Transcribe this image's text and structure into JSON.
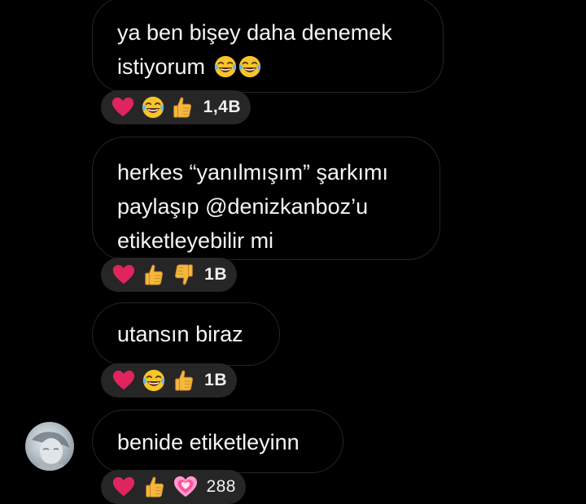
{
  "messages": [
    {
      "lines": [
        "ya ben bişey daha denemek",
        "istiyorum"
      ],
      "inline_emojis": [
        "tears-of-joy",
        "tears-of-joy"
      ],
      "reactions": [
        "red-heart",
        "tears-of-joy",
        "thumbs-up"
      ],
      "count": "1,4B"
    },
    {
      "lines": [
        "herkes “yanılmışım” şarkımı",
        "paylaşıp @denizkanboz’u",
        "etiketleyebilir mi"
      ],
      "reactions": [
        "red-heart",
        "thumbs-up",
        "thumbs-down"
      ],
      "count": "1B"
    },
    {
      "lines": [
        "utansın biraz"
      ],
      "reactions": [
        "red-heart",
        "tears-of-joy",
        "thumbs-up"
      ],
      "count": "1B"
    },
    {
      "lines": [
        "benide etiketleyinn"
      ],
      "reactions": [
        "red-heart",
        "thumbs-up",
        "growing-heart"
      ],
      "count": "288"
    }
  ],
  "colors": {
    "background": "#000000",
    "bubble_border": "#262626",
    "reaction_pill": "#262626",
    "text": "#f5f5f5",
    "heart": "#e0245e",
    "emoji_yellow": "#f7c52b",
    "pink_heart": "#ff5fa8"
  }
}
